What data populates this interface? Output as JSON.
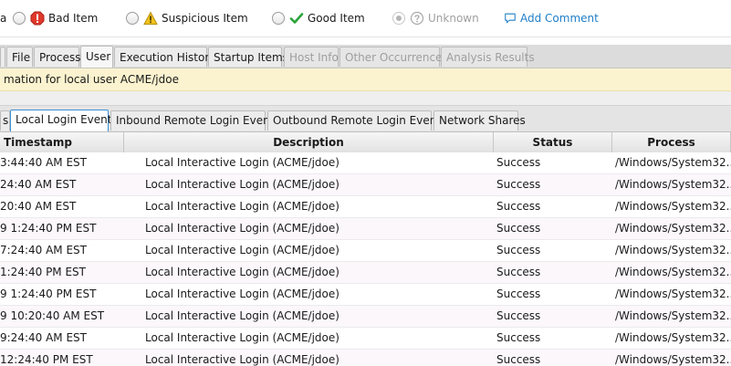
{
  "classification": {
    "partial_label": "a",
    "bad_label": "Bad Item",
    "suspicious_label": "Suspicious Item",
    "good_label": "Good Item",
    "unknown_label": "Unknown",
    "add_comment_label": "Add Comment",
    "colors": {
      "bad": "#e0392b",
      "suspicious": "#f2c21b",
      "good": "#2aa43a",
      "link": "#1f7fc8"
    }
  },
  "main_tabs": [
    {
      "label": "File"
    },
    {
      "label": "Process"
    },
    {
      "label": "User"
    },
    {
      "label": "Execution History"
    },
    {
      "label": "Startup Items"
    },
    {
      "label": "Host Info"
    },
    {
      "label": "Other Occurrences"
    },
    {
      "label": "Analysis Results"
    }
  ],
  "info_bar": {
    "text": "mation for local user ACME/jdoe"
  },
  "sub_tabs": [
    {
      "label": "s"
    },
    {
      "label": "Local Login Events"
    },
    {
      "label": "Inbound Remote Login Events"
    },
    {
      "label": "Outbound Remote Login Events"
    },
    {
      "label": "Network Shares"
    }
  ],
  "table": {
    "columns": [
      "Timestamp",
      "Description",
      "Status",
      "Process"
    ],
    "rows": [
      [
        "3:44:40 AM EST",
        "Local Interactive Login (ACME/jdoe)",
        "Success",
        "/Windows/System32..."
      ],
      [
        "24:40 AM EST",
        "Local Interactive Login (ACME/jdoe)",
        "Success",
        "/Windows/System32..."
      ],
      [
        "20:40 AM EST",
        "Local Interactive Login (ACME/jdoe)",
        "Success",
        "/Windows/System32..."
      ],
      [
        "9 1:24:40 PM EST",
        "Local Interactive Login (ACME/jdoe)",
        "Success",
        "/Windows/System32..."
      ],
      [
        "7:24:40 AM EST",
        "Local Interactive Login (ACME/jdoe)",
        "Success",
        "/Windows/System32..."
      ],
      [
        "1:24:40 PM EST",
        "Local Interactive Login (ACME/jdoe)",
        "Success",
        "/Windows/System32..."
      ],
      [
        "9 1:24:40 PM EST",
        "Local Interactive Login (ACME/jdoe)",
        "Success",
        "/Windows/System32..."
      ],
      [
        "9 10:20:40 AM EST",
        "Local Interactive Login (ACME/jdoe)",
        "Success",
        "/Windows/System32..."
      ],
      [
        "9:24:40 AM EST",
        "Local Interactive Login (ACME/jdoe)",
        "Success",
        "/Windows/System32..."
      ],
      [
        "12:24:40 PM EST",
        "Local Interactive Login (ACME/jdoe)",
        "Success",
        "/Windows/System32..."
      ]
    ]
  }
}
